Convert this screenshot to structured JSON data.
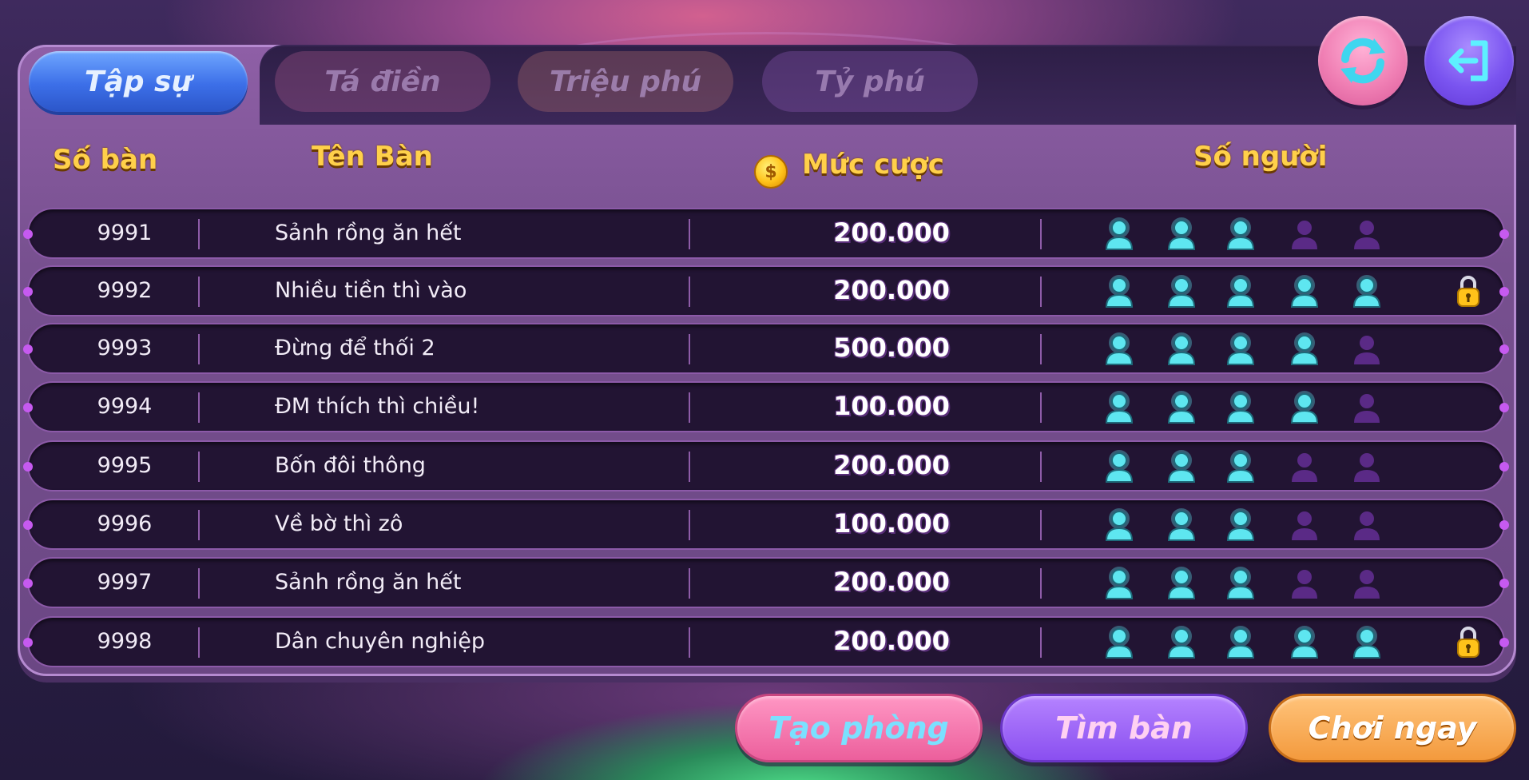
{
  "tabs": [
    {
      "label": "Tập sự",
      "active": true
    },
    {
      "label": "Tá điền",
      "active": false
    },
    {
      "label": "Triệu phú",
      "active": false
    },
    {
      "label": "Tỷ phú",
      "active": false
    }
  ],
  "toolbar": {
    "refresh_icon": "refresh-icon",
    "exit_icon": "exit-icon"
  },
  "table": {
    "headers": {
      "id": "Số bàn",
      "name": "Tên Bàn",
      "bet": "Mức cược",
      "players": "Số người"
    },
    "coin_icon": "coin-icon",
    "rows": [
      {
        "id": "9991",
        "name": "Sảnh rồng ăn hết",
        "bet": "200.000",
        "players": 3,
        "max_players": 5,
        "locked": false
      },
      {
        "id": "9992",
        "name": "Nhiều tiền thì vào",
        "bet": "200.000",
        "players": 5,
        "max_players": 5,
        "locked": true
      },
      {
        "id": "9993",
        "name": "Đừng để thối 2",
        "bet": "500.000",
        "players": 4,
        "max_players": 5,
        "locked": false
      },
      {
        "id": "9994",
        "name": "ĐM thích thì chiều!",
        "bet": "100.000",
        "players": 4,
        "max_players": 5,
        "locked": false
      },
      {
        "id": "9995",
        "name": "Bốn đôi thông",
        "bet": "200.000",
        "players": 3,
        "max_players": 5,
        "locked": false
      },
      {
        "id": "9996",
        "name": "Về bờ thì zô",
        "bet": "100.000",
        "players": 3,
        "max_players": 5,
        "locked": false
      },
      {
        "id": "9997",
        "name": "Sảnh rồng ăn hết",
        "bet": "200.000",
        "players": 3,
        "max_players": 5,
        "locked": false
      },
      {
        "id": "9998",
        "name": "Dân chuyên nghiệp",
        "bet": "200.000",
        "players": 5,
        "max_players": 5,
        "locked": true
      }
    ]
  },
  "actions": {
    "create": "Tạo phòng",
    "find": "Tìm bàn",
    "play": "Chơi ngay"
  },
  "colors": {
    "player_filled": "#5ee6f0",
    "player_empty": "#5a2a86",
    "header_text": "#ffd04a"
  }
}
